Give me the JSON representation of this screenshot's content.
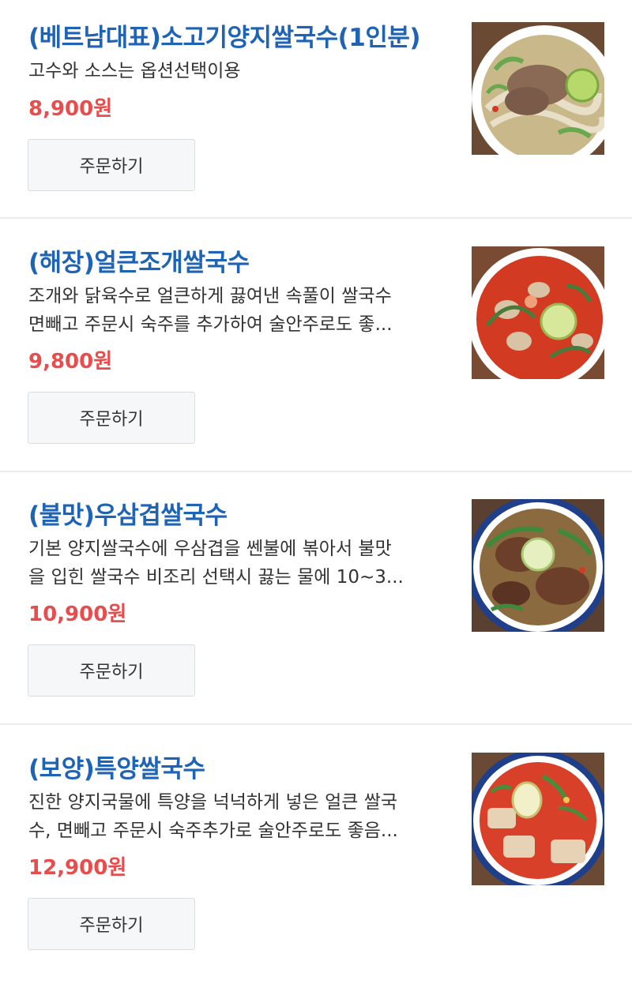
{
  "menu": {
    "items": [
      {
        "title": "(베트남대표)소고기양지쌀국수(1인분)",
        "desc": [
          "고수와 소스는 옵션선택이용"
        ],
        "price": "8,900원",
        "order_label": "주문하기",
        "thumb_icon": "beef-pho-bowl-icon",
        "colors": {
          "broth": "#c9b98a",
          "meat": "#8a6a55",
          "herb": "#6aa84f",
          "bowl": "#ffffff",
          "bg": "#6b4a34"
        }
      },
      {
        "title": "(해장)얼큰조개쌀국수",
        "desc": [
          "조개와 닭육수로 얼큰하게 끓여낸 속풀이 쌀국수",
          "면빼고 주문시 숙주를 추가하여 술안주로도 좋..."
        ],
        "price": "9,800원",
        "order_label": "주문하기",
        "thumb_icon": "clam-pho-bowl-icon",
        "colors": {
          "broth": "#d23a22",
          "meat": "#d9c3a5",
          "herb": "#4a7a3a",
          "bowl": "#ffffff",
          "bg": "#7a4b33"
        }
      },
      {
        "title": "(불맛)우삼겹쌀국수",
        "desc": [
          "기본 양지쌀국수에 우삼겹을 쎈불에 볶아서 불맛",
          "을 입힌 쌀국수 비조리 선택시 끓는 물에 10~3..."
        ],
        "price": "10,900원",
        "order_label": "주문하기",
        "thumb_icon": "brisket-pho-bowl-icon",
        "colors": {
          "broth": "#8a6a3e",
          "meat": "#6b3f2a",
          "herb": "#3f8a3a",
          "bowl": "#1f3f8a",
          "bg": "#5a4030"
        }
      },
      {
        "title": "(보양)특양쌀국수",
        "desc": [
          "진한 양지국물에 특양을 넉넉하게 넣은 얼큰 쌀국",
          "수, 면빼고 주문시 숙주추가로 술안주로도 좋음..."
        ],
        "price": "12,900원",
        "order_label": "주문하기",
        "thumb_icon": "tripe-pho-bowl-icon",
        "colors": {
          "broth": "#d8402a",
          "meat": "#e8d2b5",
          "herb": "#4f8a3a",
          "bowl": "#1f3f8a",
          "bg": "#6a4a34"
        }
      }
    ]
  }
}
